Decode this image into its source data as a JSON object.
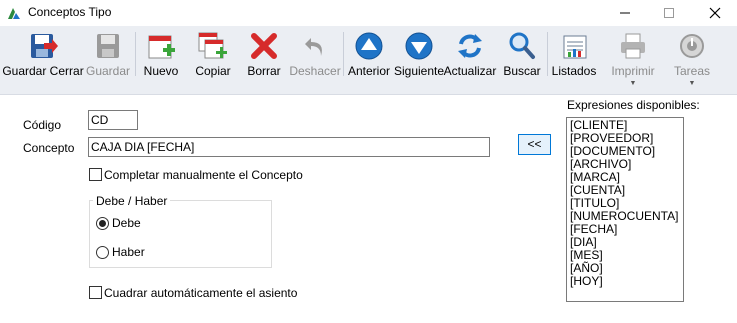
{
  "window": {
    "title": "Conceptos Tipo"
  },
  "toolbar": {
    "items": [
      {
        "label": "Guardar Cerrar",
        "icon": "save-close-icon",
        "enabled": true
      },
      {
        "label": "Guardar",
        "icon": "save-icon",
        "enabled": false
      },
      {
        "label": "Nuevo",
        "icon": "new-icon",
        "enabled": true
      },
      {
        "label": "Copiar",
        "icon": "copy-icon",
        "enabled": true
      },
      {
        "label": "Borrar",
        "icon": "delete-icon",
        "enabled": true
      },
      {
        "label": "Deshacer",
        "icon": "undo-icon",
        "enabled": false
      },
      {
        "label": "Anterior",
        "icon": "previous-icon",
        "enabled": true
      },
      {
        "label": "Siguiente",
        "icon": "next-icon",
        "enabled": true
      },
      {
        "label": "Actualizar",
        "icon": "refresh-icon",
        "enabled": true
      },
      {
        "label": "Buscar",
        "icon": "search-icon",
        "enabled": true
      },
      {
        "label": "Listados",
        "icon": "reports-icon",
        "enabled": true
      },
      {
        "label": "Imprimir",
        "icon": "printer-icon",
        "enabled": false
      },
      {
        "label": "Tareas",
        "icon": "tasks-icon",
        "enabled": false
      }
    ]
  },
  "form": {
    "codigo_label": "Código",
    "codigo_value": "CD",
    "concepto_label": "Concepto",
    "concepto_value": "CAJA DIA [FECHA]",
    "completar_label": "Completar manualmente el Concepto",
    "completar_checked": false,
    "group_label": "Debe / Haber",
    "debe_label": "Debe",
    "haber_label": "Haber",
    "selected": "Debe",
    "cuadrar_label": "Cuadrar automáticamente el asiento",
    "cuadrar_checked": false,
    "insert_label": "<<"
  },
  "expressions": {
    "title": "Expresiones disponibles:",
    "items": [
      "[CLIENTE]",
      "[PROVEEDOR]",
      "[DOCUMENTO]",
      "[ARCHIVO]",
      "[MARCA]",
      "[CUENTA]",
      "[TITULO]",
      "[NUMEROCUENTA]",
      "[FECHA]",
      "[DIA]",
      "[MES]",
      "[AÑO]",
      "[HOY]"
    ]
  },
  "colors": {
    "toolbar_bg": "#ebeef3",
    "accent_blue": "#1f74c7",
    "red": "#d62b2b",
    "green": "#3aa53a",
    "disabled_text": "#8b8b8b"
  }
}
